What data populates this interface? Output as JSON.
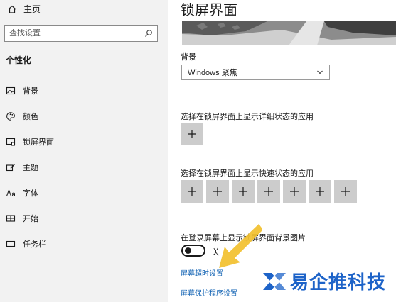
{
  "sidebar": {
    "home_label": "主页",
    "search_placeholder": "查找设置",
    "section_title": "个性化",
    "items": [
      {
        "label": "背景",
        "icon": "image-icon"
      },
      {
        "label": "颜色",
        "icon": "palette-icon"
      },
      {
        "label": "锁屏界面",
        "icon": "lock-screen-icon"
      },
      {
        "label": "主题",
        "icon": "theme-brush-icon"
      },
      {
        "label": "字体",
        "icon": "font-icon"
      },
      {
        "label": "开始",
        "icon": "start-grid-icon"
      },
      {
        "label": "任务栏",
        "icon": "taskbar-icon"
      }
    ]
  },
  "main": {
    "title": "锁屏界面",
    "background_label": "背景",
    "background_value": "Windows 聚焦",
    "detailed_status_label": "选择在锁屏界面上显示详细状态的应用",
    "quick_status_label": "选择在锁屏界面上显示快速状态的应用",
    "add_symbol": "+",
    "signin_bg_label": "在登录屏幕上显示锁屏界面背景图片",
    "toggle_state": "关",
    "toggle_on": false,
    "timeout_link": "屏幕超时设置",
    "screensaver_link": "屏幕保护程序设置"
  },
  "watermark": {
    "text": "易企推科技",
    "accent": "#1d63c8",
    "arrow_color": "#f2c02e"
  }
}
